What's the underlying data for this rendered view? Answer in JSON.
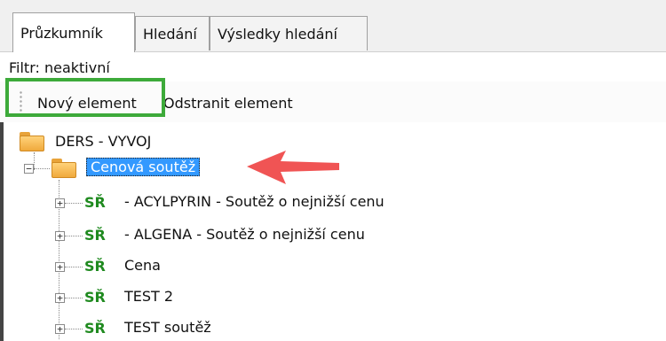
{
  "tabs": [
    {
      "label": "Průzkumník",
      "active": true
    },
    {
      "label": "Hledání",
      "active": false
    },
    {
      "label": "Výsledky hledání",
      "active": false
    }
  ],
  "filter_label": "Filtr: neaktivní",
  "toolbar": {
    "new_label": "Nový element",
    "delete_label": "Odstranit element"
  },
  "tree": {
    "root": {
      "label": "DERS - VYVOJ",
      "icon": "folder-icon"
    },
    "selected": {
      "label": "Cenová soutěž",
      "icon": "folder-icon",
      "expanded": true
    },
    "children": [
      {
        "badge": "SŘ",
        "label": " - ACYLPYRIN - Soutěž o nejnižší cenu"
      },
      {
        "badge": "SŘ",
        "label": " - ALGENA - Soutěž o nejnižší cenu"
      },
      {
        "badge": "SŘ",
        "label": "Cena"
      },
      {
        "badge": "SŘ",
        "label": "TEST 2"
      },
      {
        "badge": "SŘ",
        "label": "TEST soutěž"
      }
    ]
  },
  "colors": {
    "highlight_box": "#3daa3a",
    "arrow": "#f05454",
    "selection": "#3399ff",
    "badge": "#1f8a1f"
  }
}
